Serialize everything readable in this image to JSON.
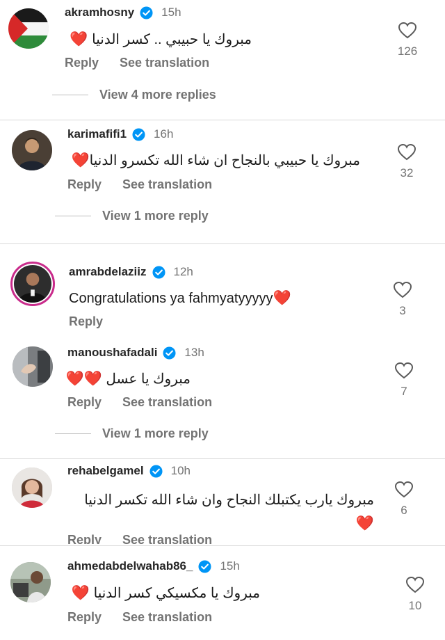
{
  "comments": [
    {
      "username": "akramhosny",
      "time": "15h",
      "text": "مبروك يا حبيبي .. كسر الدنيا",
      "hearts": "❤️",
      "likes": "126",
      "reply": "Reply",
      "translate": "See translation",
      "more_replies": "View 4 more replies"
    },
    {
      "username": "karimafifi1",
      "time": "16h",
      "text": "مبروك يا حبيبي بالنجاح ان شاء الله تكسرو الدنيا",
      "hearts": "❤️",
      "likes": "32",
      "reply": "Reply",
      "translate": "See translation",
      "more_replies": "View 1 more reply"
    },
    {
      "username": "amrabdelaziiz",
      "time": "12h",
      "text": "Congratulations ya fahmyatyyyyy",
      "hearts": "❤️",
      "likes": "3",
      "reply": "Reply"
    },
    {
      "username": "manoushafadali",
      "time": "13h",
      "text": "مبروك يا عسل",
      "hearts": "❤️❤️",
      "likes": "7",
      "reply": "Reply",
      "translate": "See translation",
      "more_replies": "View 1 more reply"
    },
    {
      "username": "rehabelgamel",
      "time": "10h",
      "text": "مبروك يارب يكتبلك النجاح وان شاء الله تكسر الدنيا",
      "hearts": "❤️",
      "likes": "6",
      "reply": "Reply",
      "translate": "See translation"
    },
    {
      "username": "ahmedabdelwahab86_",
      "time": "15h",
      "text": "مبروك يا مكسيكي كسر الدنيا",
      "hearts": "❤️",
      "likes": "10",
      "reply": "Reply",
      "translate": "See translation"
    }
  ],
  "colors": {
    "verified": "#0095f6",
    "secondary_text": "#737373",
    "heart": "#e0245e",
    "story_ring": "#c92b8b"
  }
}
